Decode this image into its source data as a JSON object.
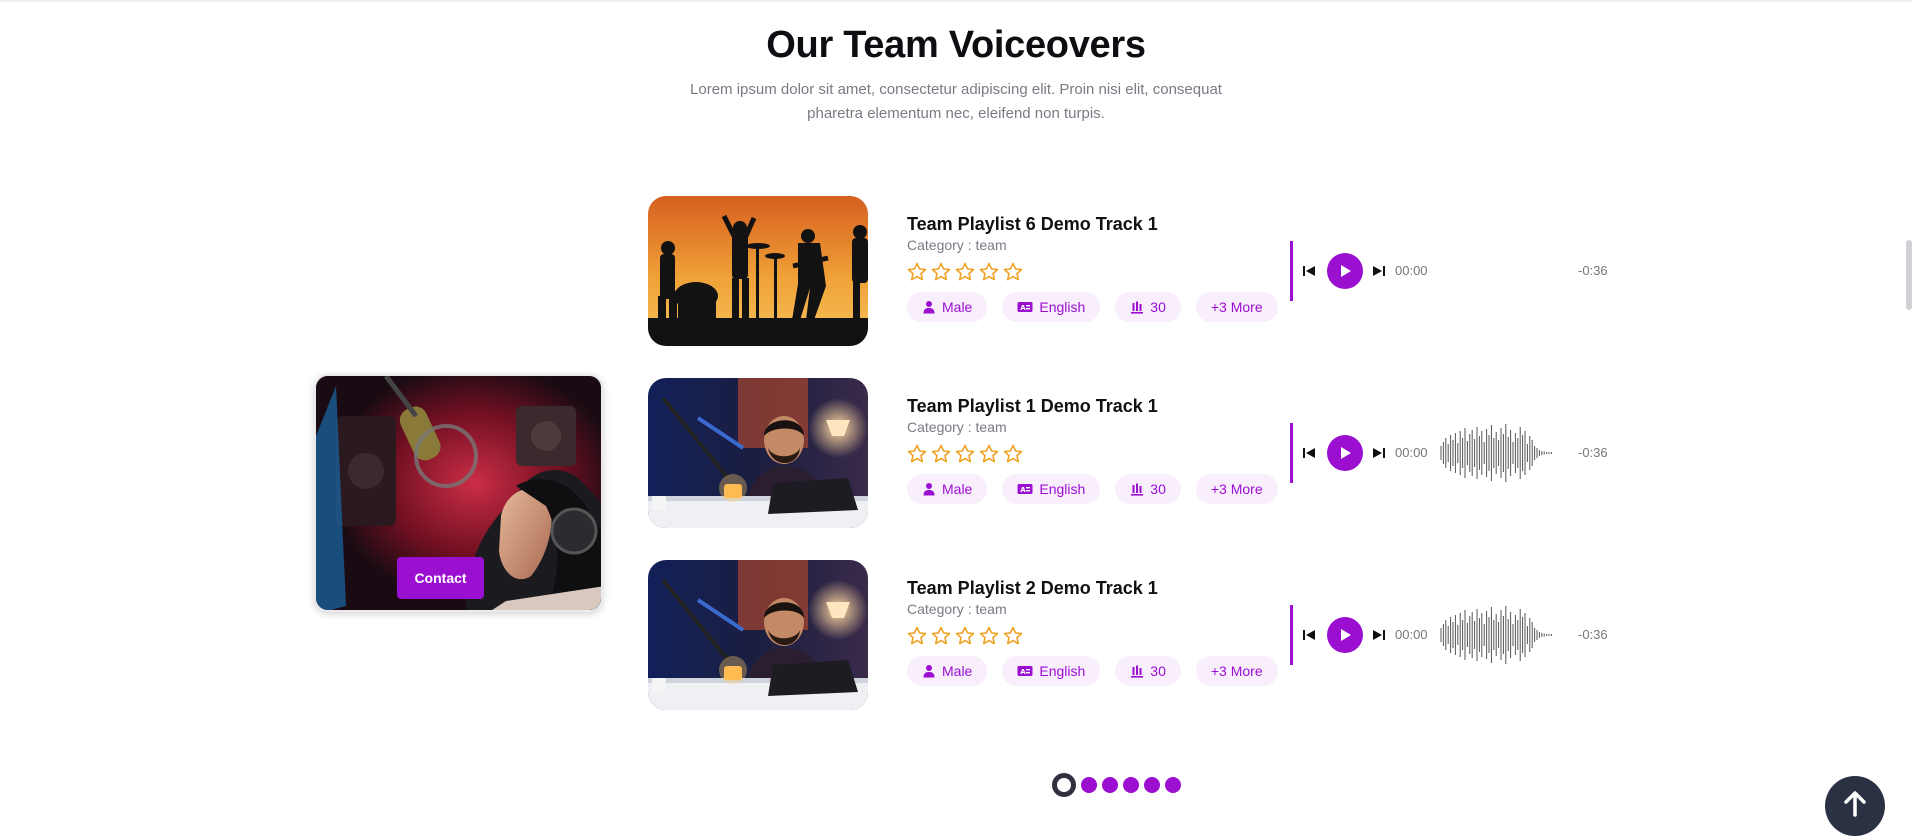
{
  "section": {
    "title": "Our Team Voiceovers",
    "description": "Lorem ipsum dolor sit amet, consectetur adipiscing elit. Proin nisi elit, consequat pharetra elementum nec, eleifend non turpis."
  },
  "side_card": {
    "contact_label": "Contact"
  },
  "tracks": [
    {
      "title": "Team Playlist 6 Demo Track 1",
      "category": "Category : team",
      "rating": 0,
      "tags": {
        "gender": "Male",
        "language": "English",
        "age": "30",
        "more": "+3 More"
      },
      "time_current": "00:00",
      "time_remaining": "-0:36",
      "waveform_visible": false
    },
    {
      "title": "Team Playlist 1 Demo Track 1",
      "category": "Category : team",
      "rating": 0,
      "tags": {
        "gender": "Male",
        "language": "English",
        "age": "30",
        "more": "+3 More"
      },
      "time_current": "00:00",
      "time_remaining": "-0:36",
      "waveform_visible": true
    },
    {
      "title": "Team Playlist 2 Demo Track 1",
      "category": "Category : team",
      "rating": 0,
      "tags": {
        "gender": "Male",
        "language": "English",
        "age": "30",
        "more": "+3 More"
      },
      "time_current": "00:00",
      "time_remaining": "-0:36",
      "waveform_visible": true
    }
  ],
  "pagination": {
    "total": 6,
    "active_index": 0
  },
  "colors": {
    "accent": "#9b0fd1",
    "star": "#f0a224",
    "tag_bg": "#f9eefc",
    "dark": "#2a3142"
  },
  "icons": {
    "prev": "skip-back-icon",
    "play": "play-icon",
    "next": "skip-forward-icon",
    "gender": "user-icon",
    "language": "translate-icon",
    "age": "bars-icon",
    "to_top": "arrow-up-icon"
  }
}
